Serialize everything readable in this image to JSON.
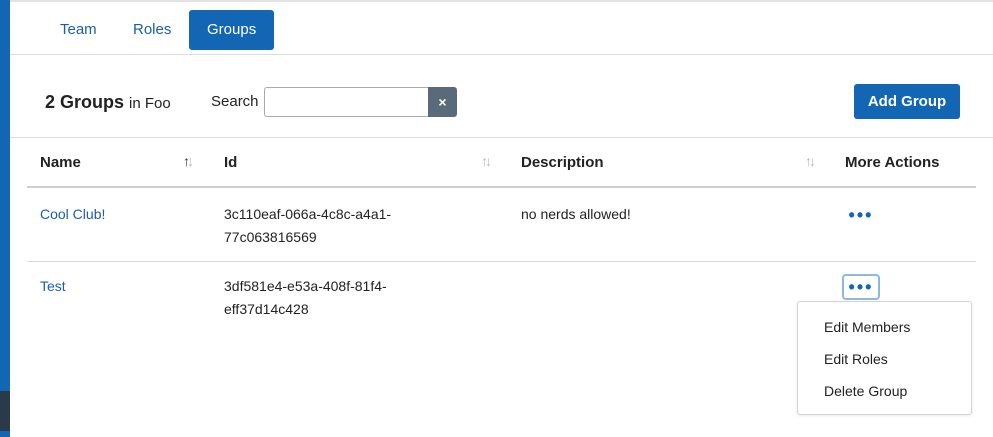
{
  "tabs": [
    {
      "label": "Team",
      "active": false
    },
    {
      "label": "Roles",
      "active": false
    },
    {
      "label": "Groups",
      "active": true
    }
  ],
  "header": {
    "count_title": "2 Groups",
    "in_text": "in Foo",
    "search_label": "Search",
    "search_value": "",
    "clear_label": "×",
    "add_button": "Add Group"
  },
  "table": {
    "columns": [
      {
        "label": "Name",
        "sort": "ascending"
      },
      {
        "label": "Id",
        "sort": "none"
      },
      {
        "label": "Description",
        "sort": "none"
      },
      {
        "label": "More Actions",
        "sort": "none"
      }
    ],
    "rows": [
      {
        "name": "Cool Club!",
        "id_line1": "3c110eaf-066a-4c8c-a4a1-",
        "id_line2": "77c063816569",
        "description": "no nerds allowed!",
        "actions": "•••"
      },
      {
        "name": "Test",
        "id_line1": "3df581e4-e53a-408f-81f4-",
        "id_line2": "eff37d14c428",
        "description": "",
        "actions": "•••"
      }
    ]
  },
  "actions_menu": {
    "items": [
      "Edit Members",
      "Edit Roles",
      "Delete Group"
    ]
  },
  "icons": {
    "sort": "sort-arrows-icon",
    "clear": "close-icon",
    "more": "ellipsis-icon"
  },
  "colors": {
    "accent": "#1366b3",
    "link": "#1a5fa8",
    "clear_button": "#596a7a"
  }
}
